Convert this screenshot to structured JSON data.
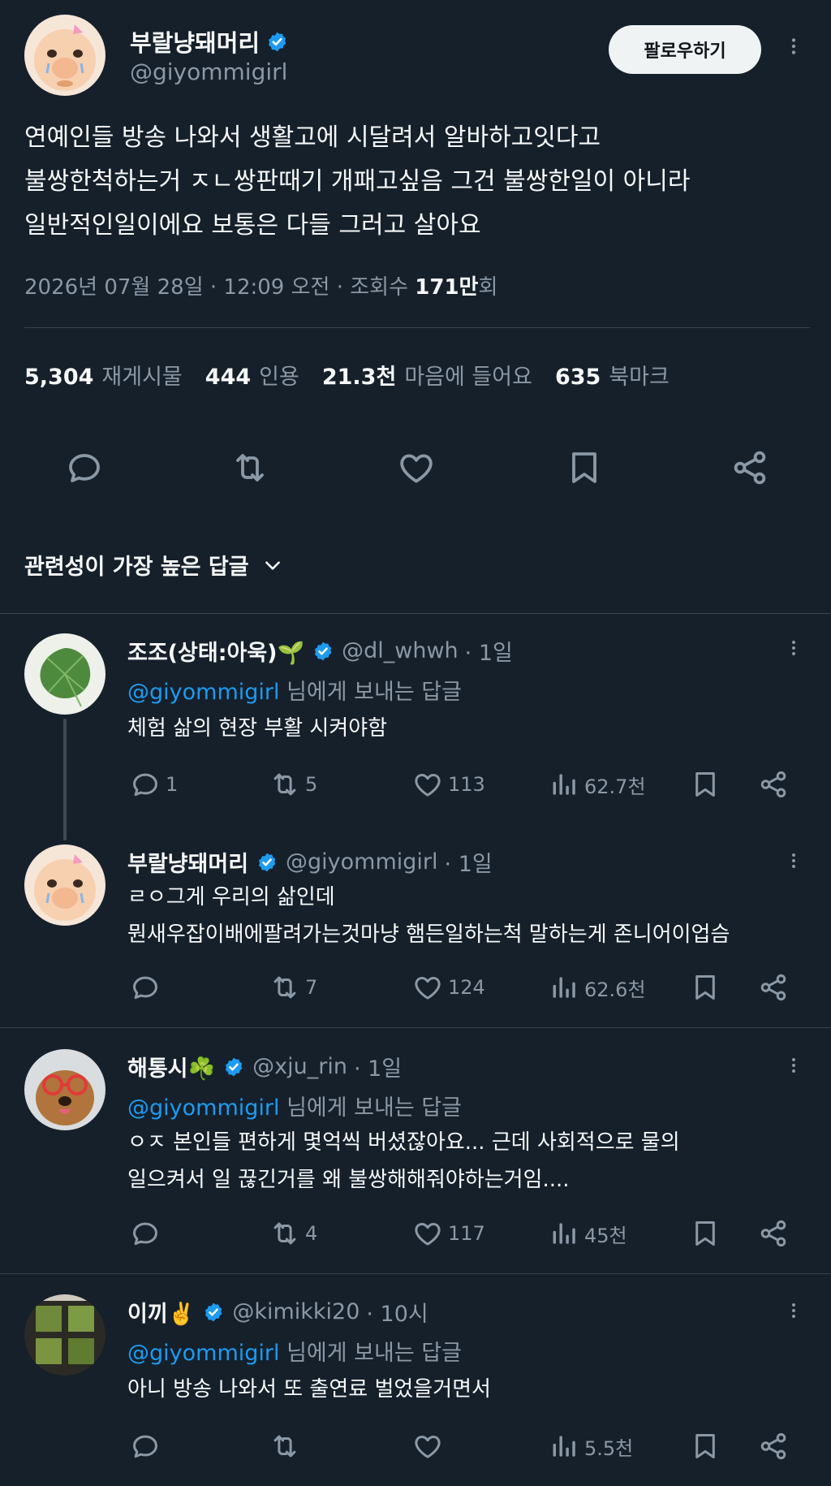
{
  "colors": {
    "background": "#15202b",
    "text": "#f7f9f9",
    "muted": "#8b98a5",
    "accent": "#1d9bf0",
    "divider": "#38444d",
    "follow_bg": "#eff3f4"
  },
  "main_tweet": {
    "author_name": "부랄냥돼머리",
    "author_handle": "@giyommigirl",
    "follow_label": "팔로우하기",
    "text_lines": [
      "연예인들 방송 나와서 생활고에 시달려서 알바하고잇다고",
      "불쌍한척하는거 ㅈㄴ쌍판때기 개패고싶음 그건 불쌍한일이 아니라",
      "일반적인일이에요 보통은 다들 그러고 살아요"
    ],
    "timestamp": "2026년 07월 28일 · 12:09 오전 · 조회수 ",
    "views": "171만",
    "views_suffix": "회",
    "stats": {
      "retweets": "5,304",
      "retweets_label": "재게시물",
      "quotes": "444",
      "quotes_label": "인용",
      "likes": "21.3천",
      "likes_label": "마음에 들어요",
      "bookmarks": "635",
      "bookmarks_label": "북마크"
    }
  },
  "sort_label": "관련성이 가장 높은 답글",
  "replies": [
    {
      "name": "조조(상태:아욱)🌱",
      "handle": "@dl_whwh",
      "time": "· 1일",
      "replying_to": "@giyommigirl",
      "replying_suffix": " 님에게 보내는 답글",
      "lines": [
        "체험 삶의 현장 부활 시켜야함"
      ],
      "replies": "1",
      "retweets": "5",
      "likes": "113",
      "views": "62.7천"
    },
    {
      "name": "부랄냥돼머리",
      "handle": "@giyommigirl",
      "time": "· 1일",
      "lines": [
        "ㄹㅇ그게 우리의 삶인데",
        "뭔새우잡이배에팔려가는것마냥 햄든일하는척 말하는게 존니어이업슴"
      ],
      "replies": "",
      "retweets": "7",
      "likes": "124",
      "views": "62.6천"
    },
    {
      "name": "해통시☘️",
      "handle": "@xju_rin",
      "time": "· 1일",
      "replying_to": "@giyommigirl",
      "replying_suffix": " 님에게 보내는 답글",
      "lines": [
        "ㅇㅈ 본인들 편하게 몇억씩 버셨잖아요... 근데 사회적으로 물의",
        "일으켜서 일 끊긴거를 왜 불쌍해해줘야하는거임...."
      ],
      "replies": "",
      "retweets": "4",
      "likes": "117",
      "views": "45천"
    },
    {
      "name": "이끼✌️",
      "handle": "@kimikki20",
      "time": "· 10시",
      "replying_to": "@giyommigirl",
      "replying_suffix": " 님에게 보내는 답글",
      "lines": [
        "아니 방송 나와서 또 출연료 벌었을거면서"
      ],
      "replies": "",
      "retweets": "",
      "likes": "",
      "views": "5.5천"
    }
  ],
  "icons": {
    "verified": "verified-badge-icon",
    "more": "more-dots-icon",
    "reply": "reply-icon",
    "retweet": "retweet-icon",
    "like": "heart-icon",
    "bookmark": "bookmark-icon",
    "share": "share-icon",
    "views": "views-chart-icon",
    "chevron": "chevron-down-icon"
  }
}
